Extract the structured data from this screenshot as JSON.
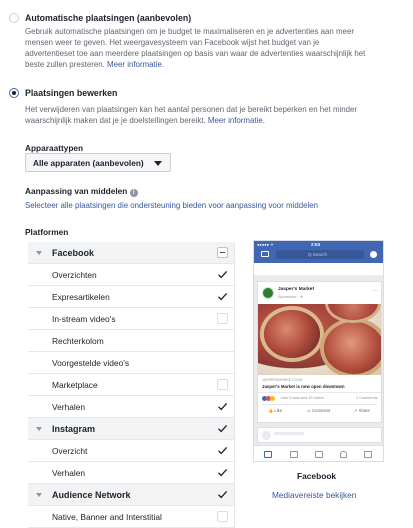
{
  "auto_option": {
    "title": "Automatische plaatsingen (aanbevolen)",
    "desc_lines": [
      "Gebruik automatische plaatsingen om je budget te maximaliseren en je advertenties aan meer",
      "mensen weer te geven. Het weergavesysteem van Facebook wijst het budget van je",
      "advertentieset toe aan meerdere plaatsingen op basis van waar de advertenties waarschijnlijk het"
    ],
    "desc_last": "beste zullen presteren.",
    "link": "Meer informatie."
  },
  "edit_option": {
    "title": "Plaatsingen bewerken",
    "desc_line1": "Het verwijderen van plaatsingen kan het aantal personen dat je bereikt beperken en het minder",
    "desc_line2": "waarschijnlijk maken dat je je doelstellingen bereikt.",
    "link": "Meer informatie."
  },
  "device_types": {
    "label": "Apparaattypen",
    "selected": "Alle apparaten (aanbevolen)"
  },
  "asset_customization": {
    "label": "Aanpassing van middelen",
    "link": "Selecteer alle plaatsingen die ondersteuning bieden voor aanpassing voor middelen"
  },
  "platforms": {
    "label": "Platformen",
    "rows": [
      {
        "label": "Facebook",
        "section": true,
        "state": "partial"
      },
      {
        "label": "Overzichten",
        "section": false,
        "state": "checked"
      },
      {
        "label": "Expresartikelen",
        "section": false,
        "state": "checked"
      },
      {
        "label": "In-stream video's",
        "section": false,
        "state": "unchecked"
      },
      {
        "label": "Rechterkolom",
        "section": false,
        "state": "none"
      },
      {
        "label": "Voorgestelde video's",
        "section": false,
        "state": "none"
      },
      {
        "label": "Marketplace",
        "section": false,
        "state": "unchecked"
      },
      {
        "label": "Verhalen",
        "section": false,
        "state": "checked"
      },
      {
        "label": "Instagram",
        "section": true,
        "state": "checked"
      },
      {
        "label": "Overzicht",
        "section": false,
        "state": "checked"
      },
      {
        "label": "Verhalen",
        "section": false,
        "state": "checked"
      },
      {
        "label": "Audience Network",
        "section": true,
        "state": "checked"
      },
      {
        "label": "Native, Banner and Interstitial",
        "section": false,
        "state": "unchecked"
      }
    ]
  },
  "preview": {
    "status_time": "2:04",
    "status_carrier": "●●●●● ✈",
    "search_placeholder": "Q Search",
    "page_name": "Jasper's Market",
    "sponsored": "Sponsored · ⊕",
    "link_domain": "JASPERSMARKET.COM",
    "link_title": "Jasper's Market is now open downtown",
    "reactions_text": "John Evans and 23 others",
    "comments_text": "2 Comments",
    "like": "Like",
    "comment": "Comment",
    "share": "Share",
    "caption": "Facebook",
    "media_link": "Mediavereiste bekijken"
  },
  "colors": {
    "brand_blue": "#4267b2",
    "link_blue": "#385898",
    "section_bg": "#f2f3f5"
  }
}
